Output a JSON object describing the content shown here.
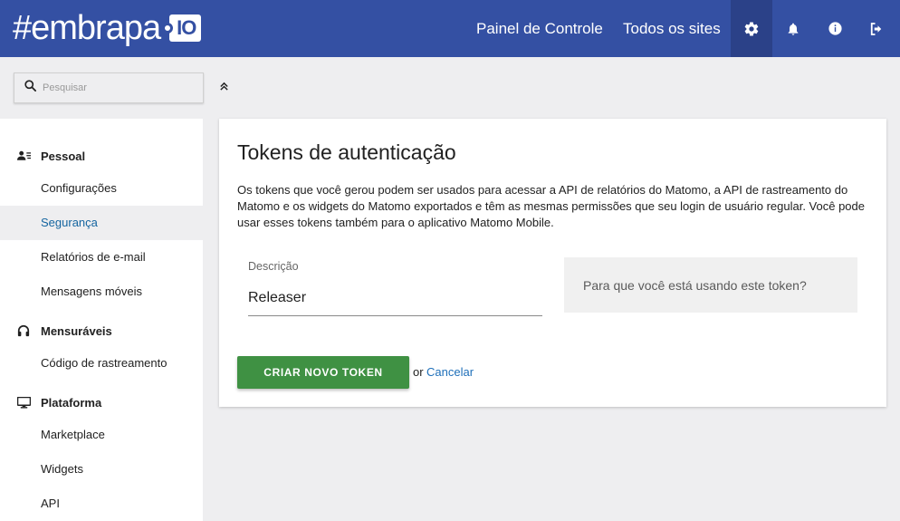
{
  "header": {
    "logo_text": "#embrapa",
    "logo_badge": "IO",
    "nav": {
      "dashboard": "Painel de Controle",
      "all_sites": "Todos os sites"
    },
    "icons": [
      "gear-icon",
      "bell-icon",
      "info-icon",
      "logout-icon"
    ],
    "colors": {
      "bar": "#3450a3",
      "active_icon_bg": "#2b4188"
    }
  },
  "search": {
    "placeholder": "Pesquisar"
  },
  "sidebar": {
    "sections": [
      {
        "title": "Pessoal",
        "icon": "person-list-icon",
        "items": [
          "Configurações",
          "Segurança",
          "Relatórios de e-mail",
          "Mensagens móveis"
        ]
      },
      {
        "title": "Mensuráveis",
        "icon": "headset-icon",
        "items": [
          "Código de rastreamento"
        ]
      },
      {
        "title": "Plataforma",
        "icon": "monitor-icon",
        "items": [
          "Marketplace",
          "Widgets",
          "API"
        ]
      }
    ],
    "active_item": "Segurança"
  },
  "card": {
    "title": "Tokens de autenticação",
    "description": "Os tokens que você gerou podem ser usados para acessar a API de relatórios do Matomo, a API de rastreamento do Matomo e os widgets do Matomo exportados e têm as mesmas permissões que seu login de usuário regular. Você pode usar esses tokens também para o aplicativo Matomo Mobile.",
    "field_label": "Descrição",
    "field_value": "Releaser",
    "help_text": "Para que você está usando este token?",
    "create_button": "CRIAR NOVO TOKEN",
    "or_text": "or",
    "cancel_link": "Cancelar",
    "colors": {
      "create_button": "#3f9143",
      "link": "#1e6fb9"
    }
  }
}
